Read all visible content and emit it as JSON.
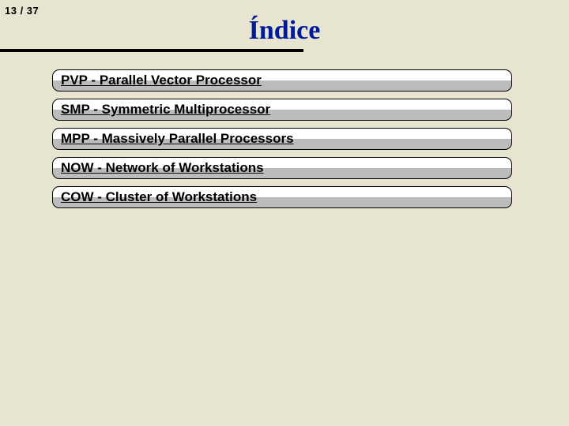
{
  "page_counter": "13 / 37",
  "title": "Índice",
  "items": [
    {
      "label": "PVP - Parallel Vector Processor"
    },
    {
      "label": "SMP - Symmetric Multiprocessor"
    },
    {
      "label": "MPP - Massively Parallel Processors"
    },
    {
      "label": "NOW - Network of Workstations"
    },
    {
      "label": "COW - Cluster of Workstations"
    }
  ]
}
